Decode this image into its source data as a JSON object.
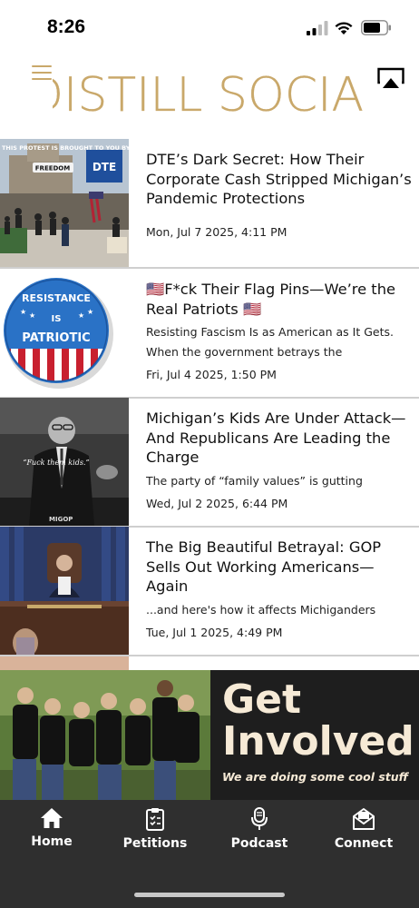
{
  "status_bar": {
    "time": "8:26"
  },
  "header": {
    "logo_text": "DISTILL SOCIAL"
  },
  "articles": [
    {
      "title": "DTE’s Dark Secret: How Their Corporate Cash Stripped Michigan’s Pandemic Protections",
      "excerpt": "",
      "date": "Mon, Jul 7 2025, 4:11 PM",
      "thumb_caption": "THIS PROTEST IS BROUGHT TO YOU BY:",
      "thumb_badge_1": "FREEDOM",
      "thumb_badge_2": "DTE"
    },
    {
      "title": "🇺🇸F*ck Their Flag Pins—We’re the Real Patriots 🇺🇸",
      "excerpt": "Resisting Fascism Is as American as It Gets. When the government betrays the",
      "date": "Fri, Jul 4 2025, 1:50 PM",
      "button_top": "RESISTANCE",
      "button_mid": "IS",
      "button_bottom": "PATRIOTIC"
    },
    {
      "title": "Michigan’s Kids Are Under Attack—And Republicans Are Leading the Charge",
      "excerpt": "The party of “family values” is gutting",
      "date": "Wed, Jul 2 2025, 6:44 PM",
      "thumb_quote": "“Fuck them kids.”",
      "thumb_corner": "MIGOP"
    },
    {
      "title": "The Big Beautiful Betrayal: GOP Sells Out Working Americans—Again",
      "excerpt": "...and here's how it affects Michiganders",
      "date": "Tue, Jul 1 2025, 4:49 PM"
    }
  ],
  "banner": {
    "line1": "Get",
    "line2": "Involved",
    "tagline": "We are doing some cool stuff"
  },
  "nav": [
    {
      "label": "Home",
      "icon": "home-icon"
    },
    {
      "label": "Petitions",
      "icon": "clipboard-icon"
    },
    {
      "label": "Podcast",
      "icon": "microphone-icon"
    },
    {
      "label": "Connect",
      "icon": "envelope-icon"
    }
  ],
  "colors": {
    "gold": "#c9a86a",
    "nav_bg": "#2f2f2f",
    "banner_bg": "#1e1e1e",
    "cream": "#f6ead6"
  }
}
